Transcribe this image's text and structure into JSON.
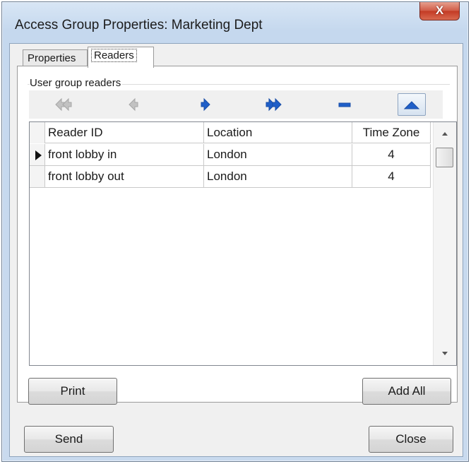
{
  "window": {
    "title": "Access Group Properties: Marketing Dept",
    "close_glyph": "X"
  },
  "tabs": [
    {
      "label": "Properties",
      "active": false
    },
    {
      "label": "Readers",
      "active": true
    }
  ],
  "readers_panel": {
    "group_label": "User group readers",
    "nav_icons": [
      "move-all-left-icon",
      "move-left-icon",
      "move-right-icon",
      "move-all-right-icon",
      "remove-icon",
      "move-up-icon"
    ],
    "grid": {
      "columns": [
        "Reader ID",
        "Location",
        "Time Zone"
      ],
      "rows": [
        {
          "reader_id": "front lobby in",
          "location": "London",
          "time_zone": "4",
          "current": true
        },
        {
          "reader_id": "front lobby out",
          "location": "London",
          "time_zone": "4",
          "current": false
        }
      ]
    },
    "print_label": "Print",
    "add_all_label": "Add All"
  },
  "footer": {
    "send_label": "Send",
    "close_label": "Close"
  },
  "colors": {
    "accent_blue": "#1f5fc8",
    "disabled_gray": "#b4b4b4"
  }
}
